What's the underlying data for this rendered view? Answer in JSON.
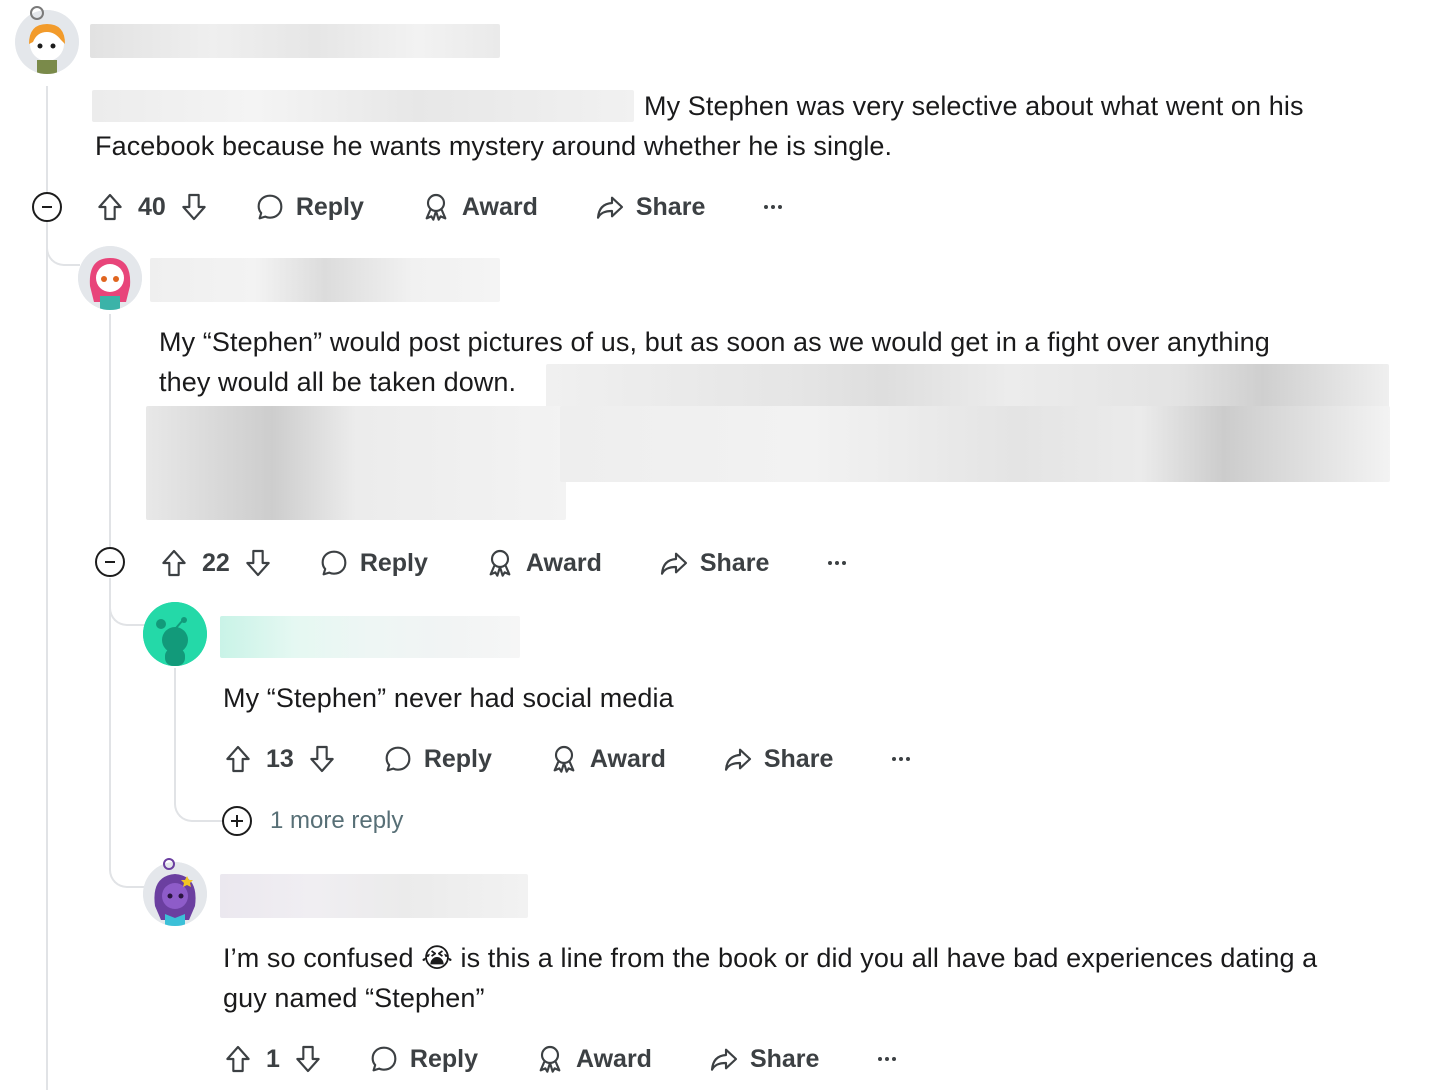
{
  "comments": [
    {
      "body_prefix_hidden": true,
      "body": "My Stephen was very selective about what went on his Facebook because he wants mystery around whether he is single.",
      "line1": "My Stephen was very selective about what went on his",
      "line2": "Facebook because he wants mystery around whether he is single.",
      "score": "40"
    },
    {
      "line1": "My “Stephen” would post pictures of us, but as soon as we would get in a fight over anything",
      "line2": "they would all be taken down.",
      "score": "22"
    },
    {
      "line1": "My “Stephen” never had social media",
      "score": "13",
      "more_replies": "1 more reply"
    },
    {
      "line1_a": "I’m so confused",
      "emoji": "😭",
      "line1_b": "is this a line from the book or did you all have bad experiences dating a",
      "line2": "guy named “Stephen”",
      "score": "1"
    }
  ],
  "actions": {
    "reply": "Reply",
    "award": "Award",
    "share": "Share",
    "overflow": "…"
  },
  "icons": [
    "upvote-icon",
    "downvote-icon",
    "reply-icon",
    "award-icon",
    "share-icon",
    "overflow-icon",
    "collapse-icon",
    "expand-icon"
  ],
  "colors": {
    "thread_line": "#e1e3e6",
    "text": "#1a1a1b",
    "meta": "#576f76"
  }
}
